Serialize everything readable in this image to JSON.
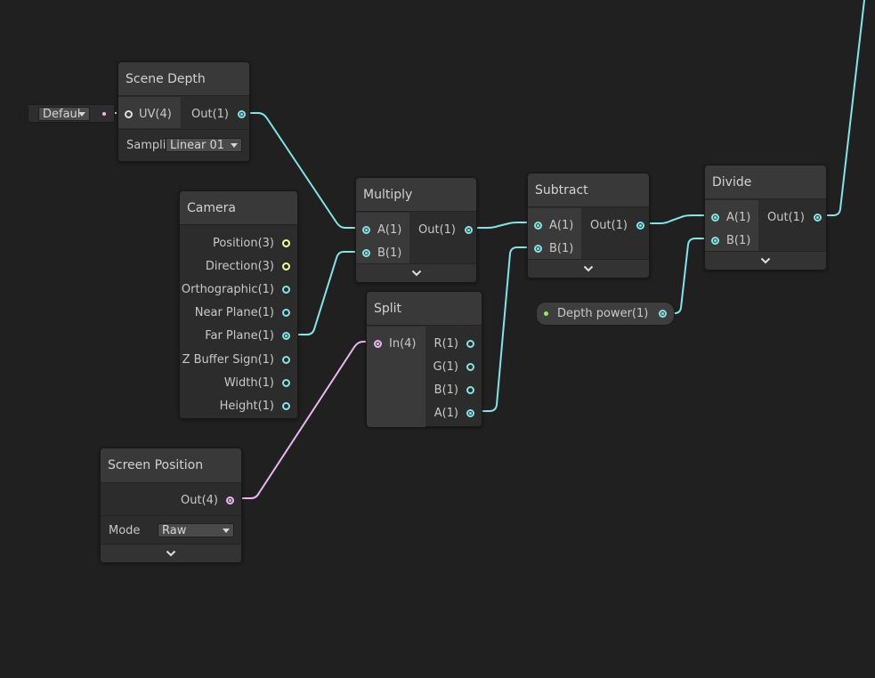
{
  "colors": {
    "background": "#202020",
    "wire_vector1": "#84e4e7",
    "wire_vector4": "#eeb5f3",
    "port_vector3": "#f6ff9a",
    "property_dot": "#9ae85c"
  },
  "default_input": {
    "label": "Defaul",
    "icon": "dropdown-arrow-icon"
  },
  "scene_depth": {
    "title": "Scene Depth",
    "input": "UV(4)",
    "output": "Out(1)",
    "sampling_label": "Samplin",
    "sampling_value": "Linear 01"
  },
  "camera": {
    "title": "Camera",
    "outputs": [
      "Position(3)",
      "Direction(3)",
      "Orthographic(1)",
      "Near Plane(1)",
      "Far Plane(1)",
      "Z Buffer Sign(1)",
      "Width(1)",
      "Height(1)"
    ]
  },
  "multiply": {
    "title": "Multiply",
    "inputs": [
      "A(1)",
      "B(1)"
    ],
    "output": "Out(1)",
    "expand_icon": "chevron-down-icon"
  },
  "split": {
    "title": "Split",
    "input": "In(4)",
    "outputs": [
      "R(1)",
      "G(1)",
      "B(1)",
      "A(1)"
    ]
  },
  "subtract": {
    "title": "Subtract",
    "inputs": [
      "A(1)",
      "B(1)"
    ],
    "output": "Out(1)",
    "expand_icon": "chevron-down-icon"
  },
  "divide": {
    "title": "Divide",
    "inputs": [
      "A(1)",
      "B(1)"
    ],
    "output": "Out(1)",
    "expand_icon": "chevron-down-icon"
  },
  "depth_power": {
    "label": "Depth power(1)"
  },
  "screen_position": {
    "title": "Screen Position",
    "output": "Out(4)",
    "mode_label": "Mode",
    "mode_value": "Raw",
    "expand_icon": "chevron-down-icon"
  }
}
